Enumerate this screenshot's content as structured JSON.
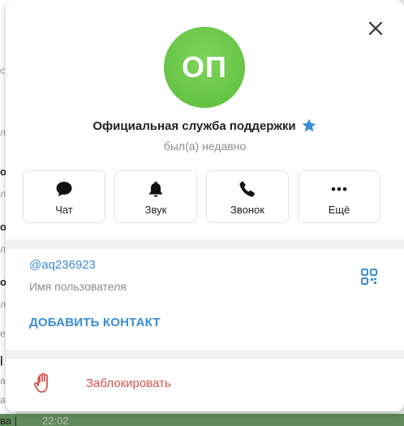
{
  "background": {
    "fragments": [
      "с",
      "ле",
      "о",
      "ле",
      "о",
      "ле",
      "о",
      "ле",
      "е",
      "|",
      "а",
      "а"
    ],
    "bottom_text": "ва |",
    "bottom_time": "22:02"
  },
  "profile": {
    "avatar_initials": "ОП",
    "name": "Официальная служба поддержки",
    "status": "был(а) недавно"
  },
  "actions": [
    {
      "label": "Чат",
      "icon": "chat-icon"
    },
    {
      "label": "Звук",
      "icon": "bell-icon"
    },
    {
      "label": "Звонок",
      "icon": "phone-icon"
    },
    {
      "label": "Ещё",
      "icon": "more-icon"
    }
  ],
  "info": {
    "username": "@aq236923",
    "username_label": "Имя пользователя",
    "add_contact": "ДОБАВИТЬ КОНТАКТ"
  },
  "block": {
    "label": "Заблокировать"
  },
  "colors": {
    "accent": "#3a8dd3",
    "avatar": "#5bbd3c",
    "danger": "#d9534f",
    "verified_star": "#3a8dd3"
  }
}
